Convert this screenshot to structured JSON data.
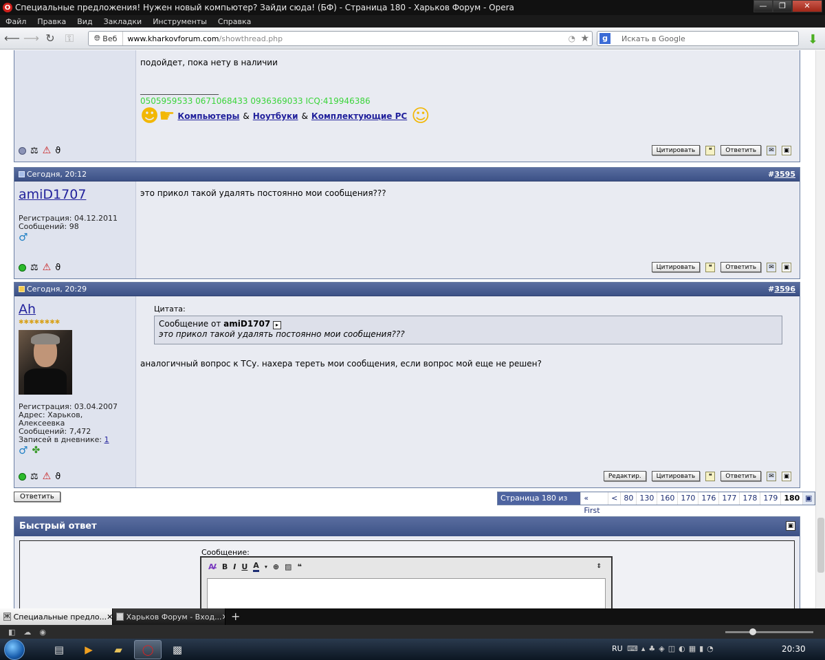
{
  "window": {
    "title": "Специальные предложения! Нужен новый компьютер? Зайди сюда! (БФ) - Страница 180 - Харьков Форум - Opera",
    "buttons": [
      "—",
      "❐",
      "✕"
    ]
  },
  "menu": [
    "Файл",
    "Правка",
    "Вид",
    "Закладки",
    "Инструменты",
    "Справка"
  ],
  "address": {
    "web_label": "Веб",
    "url_domain": "www.kharkovforum.com",
    "url_path": "/showthread.php",
    "search_placeholder": "Искать в Google"
  },
  "posts": [
    {
      "partial": true,
      "body_text": "подойдет, пока нету в наличии",
      "signature_line": "___________________",
      "signature_phones": "0505959533 0671068433 0936369033 ICQ:419946386",
      "signature_links": [
        "Компьютеры",
        "Ноутбуки",
        "Комплектующие PC"
      ],
      "signature_amp": "&",
      "buttons": [
        "Цитировать",
        "Ответить"
      ]
    },
    {
      "date": "Сегодня, 20:12",
      "num_prefix": "#",
      "num": "3595",
      "username": "amiD1707",
      "reg": "Регистрация: 04.12.2011",
      "msgs": "Сообщений: 98",
      "gender": "♂",
      "body_text": "это прикол такой удалять постоянно мои сообщения???",
      "buttons": [
        "Цитировать",
        "Ответить"
      ]
    },
    {
      "date": "Сегодня, 20:29",
      "num_prefix": "#",
      "num": "3596",
      "username": "Ah",
      "stars": "✱✱✱✱✱✱✱✱",
      "reg": "Регистрация: 03.04.2007",
      "address": "Адрес: Харьков, Алексеевка",
      "msgs": "Сообщений: 7,472",
      "diary_label": "Записей в дневнике:",
      "diary_count": "1",
      "gender": "♂",
      "quote_label": "Цитата:",
      "quote_from_prefix": "Сообщение от",
      "quote_author": "amiD1707",
      "quote_text": "это прикол такой удалять постоянно мои сообщения???",
      "body_text": "аналогичный вопрос к ТСу. нахера тереть мои сообщения, если вопрос мой еще не решен?",
      "buttons": [
        "Редактир.",
        "Цитировать",
        "Ответить"
      ]
    }
  ],
  "reply_button": "Ответить",
  "pagination": {
    "info": "Страница 180 из 180",
    "first": "« First",
    "prev": "<",
    "pages": [
      "80",
      "130",
      "160",
      "170",
      "176",
      "177",
      "178",
      "179"
    ],
    "current": "180"
  },
  "quick_reply": {
    "title": "Быстрый ответ",
    "message_label": "Сообщение:",
    "toolbar": [
      "B",
      "I",
      "U",
      "A"
    ]
  },
  "tabs": [
    {
      "label": "Специальные предло...",
      "active": true
    },
    {
      "label": "Харьков Форум - Вход...",
      "active": false
    }
  ],
  "taskbar": {
    "lang": "RU",
    "clock": "20:30"
  }
}
